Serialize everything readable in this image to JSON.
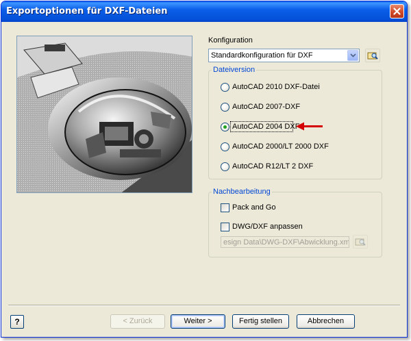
{
  "window": {
    "title": "Exportoptionen für DXF-Dateien"
  },
  "configuration": {
    "label": "Konfiguration",
    "selected": "Standardkonfiguration für DXF"
  },
  "file_version": {
    "title": "Dateiversion",
    "options": [
      {
        "label": "AutoCAD 2010 DXF-Datei",
        "checked": false
      },
      {
        "label": "AutoCAD 2007-DXF",
        "checked": false
      },
      {
        "label": "AutoCAD 2004 DXF",
        "checked": true
      },
      {
        "label": "AutoCAD 2000/LT 2000 DXF",
        "checked": false
      },
      {
        "label": "AutoCAD R12/LT 2 DXF",
        "checked": false
      }
    ]
  },
  "post_processing": {
    "title": "Nachbearbeitung",
    "pack_and_go": {
      "label": "Pack and Go",
      "checked": false
    },
    "customize": {
      "label": "DWG/DXF anpassen",
      "checked": false
    },
    "path_value": "esign Data\\DWG-DXF\\Abwicklung.xml"
  },
  "buttons": {
    "help": "?",
    "back": "< Zurück",
    "next": "Weiter >",
    "finish": "Fertig stellen",
    "cancel": "Abbrechen"
  },
  "colors": {
    "title_bar": "#0a5fe8",
    "group_title": "#0046d5",
    "annotation_arrow": "#d40000",
    "radio_selected": "#21a121"
  }
}
